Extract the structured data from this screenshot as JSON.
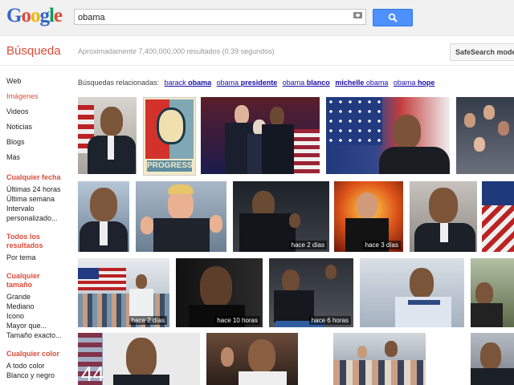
{
  "header": {
    "logo_letters": [
      {
        "ch": "G",
        "color": "#3366cc"
      },
      {
        "ch": "o",
        "color": "#dd4b39"
      },
      {
        "ch": "o",
        "color": "#f4b400"
      },
      {
        "ch": "g",
        "color": "#3366cc"
      },
      {
        "ch": "l",
        "color": "#0f9d58"
      },
      {
        "ch": "e",
        "color": "#dd4b39"
      }
    ],
    "query": "obama"
  },
  "subbar": {
    "title": "Búsqueda",
    "stats": "Aproximadamente 7,400,000,000 resultados (0.39 segundos)",
    "safesearch": "SafeSearch moderado"
  },
  "sidebar": {
    "nav": [
      {
        "label": "Web",
        "active": false
      },
      {
        "label": "Imágenes",
        "active": true
      },
      {
        "label": "Videos",
        "active": false
      },
      {
        "label": "Noticias",
        "active": false
      },
      {
        "label": "Blogs",
        "active": false
      },
      {
        "label": "Más",
        "active": false
      }
    ],
    "date_title": "Cualquier fecha",
    "date_opts": [
      "Últimas 24 horas",
      "Última semana",
      "Intervalo personalizado..."
    ],
    "results_title": "Todos los resultados",
    "results_opts": [
      "Por tema"
    ],
    "size_title": "Cualquier tamaño",
    "size_opts": [
      "Grande",
      "Mediano",
      "Icono",
      "Mayor que...",
      "Tamaño exacto..."
    ],
    "color_title": "Cualquier color",
    "color_opts": [
      "A todo color",
      "Blanco y negro"
    ]
  },
  "related": {
    "prefix": "Búsquedas relacionadas:",
    "items": [
      {
        "pre": "barack",
        "bold": "obama",
        "post": ""
      },
      {
        "pre": "obama",
        "bold": "presidente",
        "post": ""
      },
      {
        "pre": "obama",
        "bold": "blanco",
        "post": ""
      },
      {
        "pre": "",
        "bold": "michelle",
        "post": " obama"
      },
      {
        "pre": "obama",
        "bold": "hope",
        "post": ""
      }
    ]
  },
  "labels": {
    "r2_4": "hace 2 días",
    "r2_5": "hace 3 días",
    "r3_1": "hace 2 días",
    "r3_2": "hace 10 horas",
    "r3_3": "hace 6 horas",
    "r4_1_number": "44"
  }
}
